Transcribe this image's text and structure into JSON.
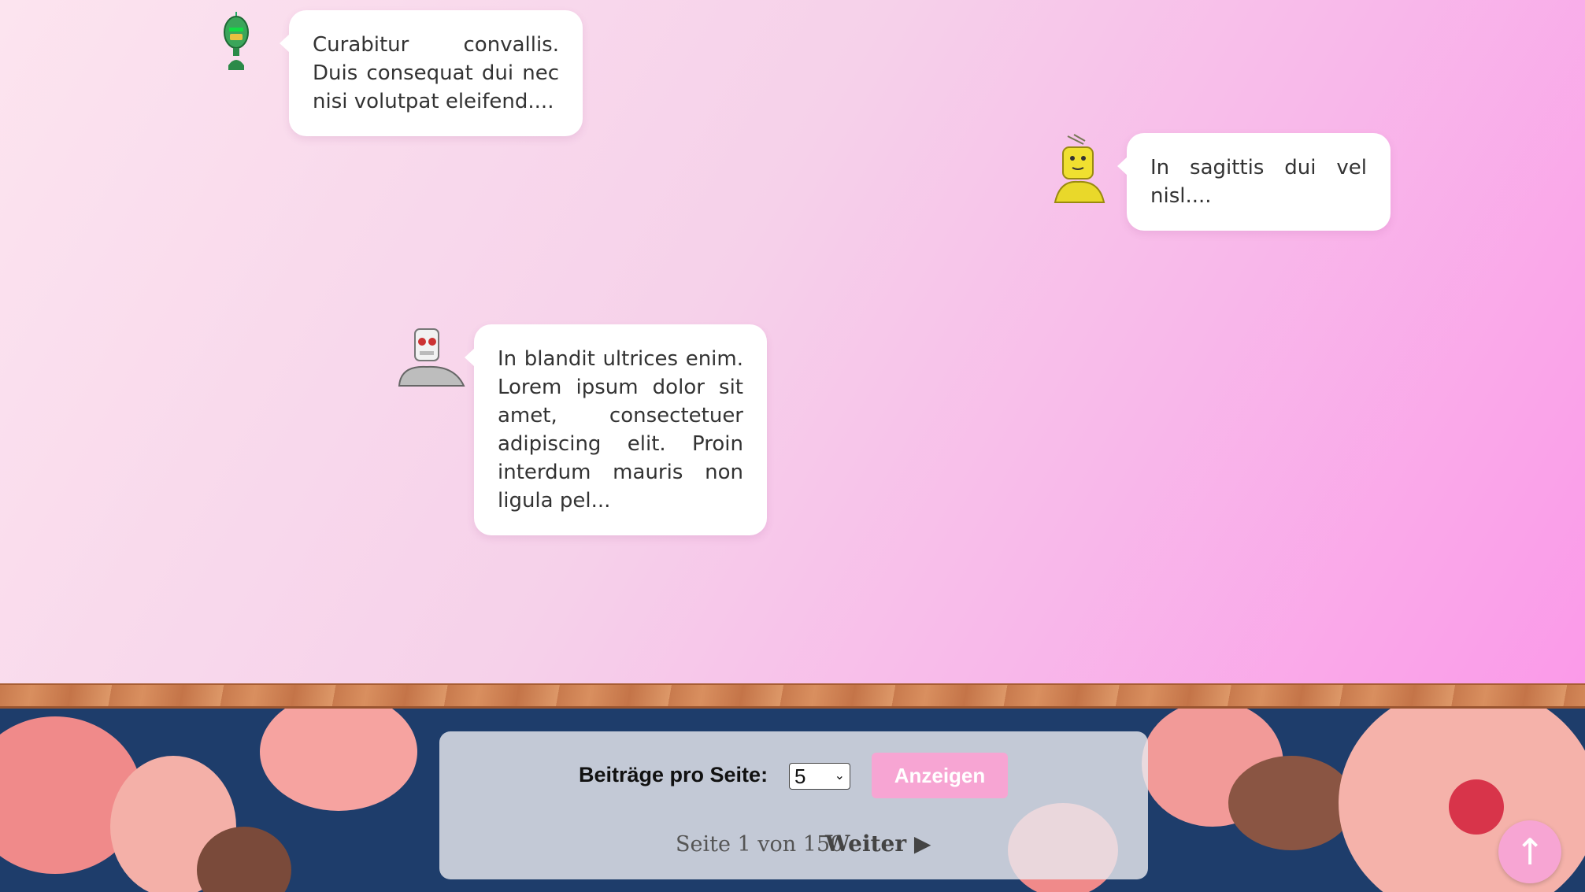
{
  "posts": [
    {
      "avatar_icon": "green-robot-icon",
      "text": "Curabitur convallis. Duis consequat dui nec nisi volutpat eleifend...."
    },
    {
      "avatar_icon": "yellow-robot-icon",
      "text": "In sagittis dui vel nisl...."
    },
    {
      "avatar_icon": "white-robot-icon",
      "text": "In blandit ultrices enim. Lorem ipsum dolor sit amet, consectetuer adipiscing elit. Proin interdum mauris non ligula pel..."
    }
  ],
  "pagination": {
    "per_page_label": "Beiträge pro Seite:",
    "per_page_value": "5",
    "show_button": "Anzeigen",
    "page_info": "Seite 1 von 150",
    "next_label": "Weiter ▶"
  },
  "scroll_top": {
    "icon": "arrow-up-icon",
    "glyph": "↑"
  },
  "colors": {
    "accent_pink": "#f7a5d3",
    "background_gradient": [
      "#fce4ef",
      "#fb9ae9"
    ]
  }
}
